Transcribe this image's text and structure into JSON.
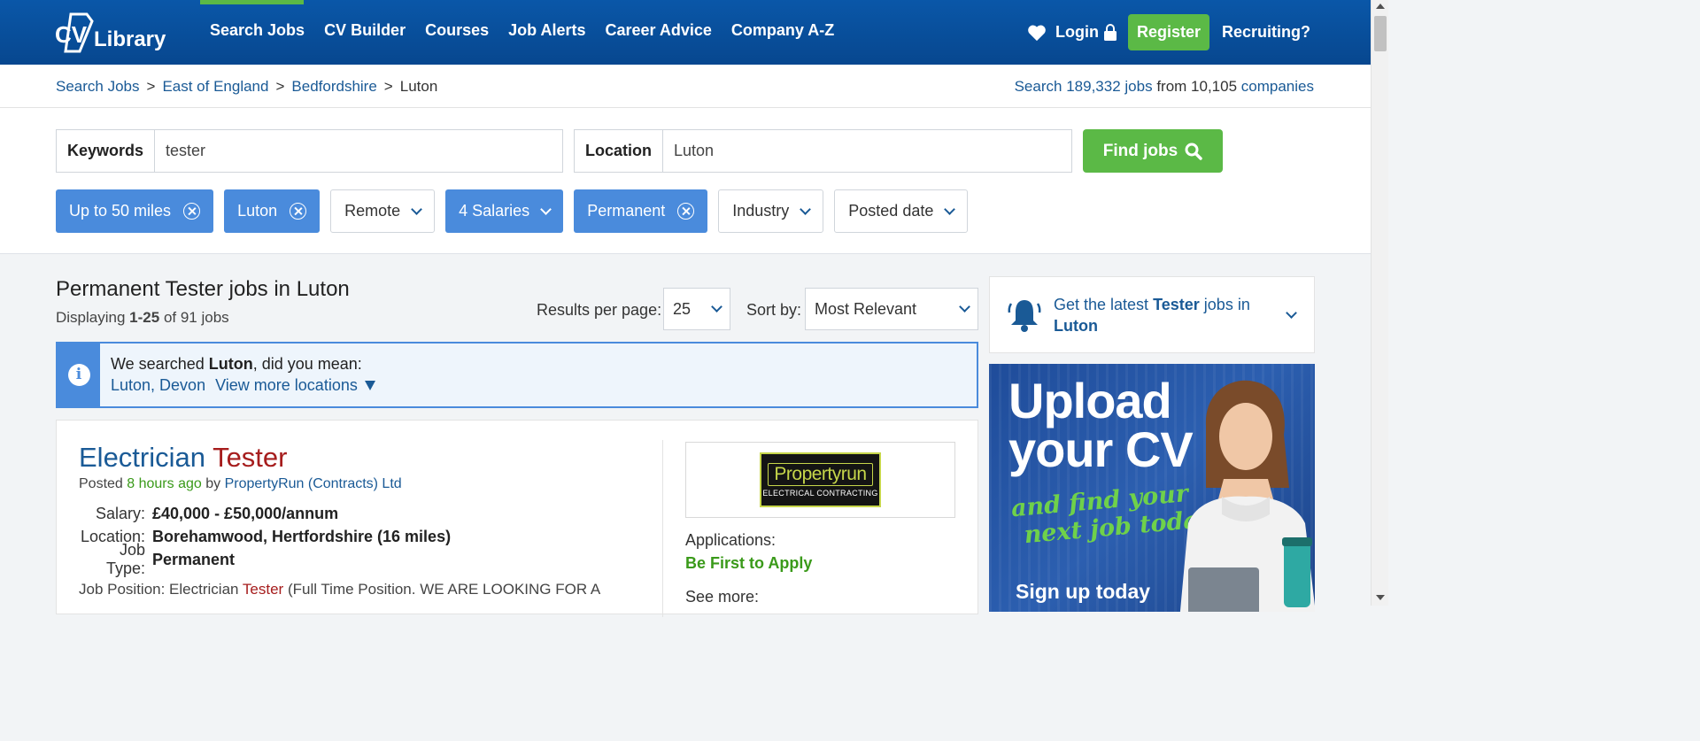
{
  "header": {
    "logo_text": "CV Library",
    "nav": [
      "Search Jobs",
      "CV Builder",
      "Courses",
      "Job Alerts",
      "Career Advice",
      "Company A-Z"
    ],
    "login": "Login",
    "register": "Register",
    "recruiting": "Recruiting?"
  },
  "breadcrumb": {
    "items": [
      "Search Jobs",
      "East of England",
      "Bedfordshire"
    ],
    "current": "Luton",
    "stats_prefix": "Search",
    "jobs_count": "189,332 jobs",
    "stats_mid": "from 10,105",
    "companies": "companies"
  },
  "search": {
    "keywords_label": "Keywords",
    "keywords_value": "tester",
    "location_label": "Location",
    "location_value": "Luton",
    "find_button": "Find jobs"
  },
  "filters": [
    {
      "label": "Up to 50 miles",
      "active": true,
      "kind": "remove"
    },
    {
      "label": "Luton",
      "active": true,
      "kind": "remove"
    },
    {
      "label": "Remote",
      "active": false,
      "kind": "dropdown"
    },
    {
      "label": "4 Salaries",
      "active": true,
      "kind": "dropdown"
    },
    {
      "label": "Permanent",
      "active": true,
      "kind": "remove"
    },
    {
      "label": "Industry",
      "active": false,
      "kind": "dropdown"
    },
    {
      "label": "Posted date",
      "active": false,
      "kind": "dropdown"
    }
  ],
  "results": {
    "title": "Permanent Tester jobs in Luton",
    "displaying_prefix": "Displaying",
    "range": "1-25",
    "of_text": "of 91 jobs",
    "per_page_label": "Results per page:",
    "per_page_value": "25",
    "sort_label": "Sort by:",
    "sort_value": "Most Relevant"
  },
  "did_you_mean": {
    "prefix": "We searched",
    "term": "Luton",
    "suffix": ", did you mean:",
    "suggestion": "Luton, Devon",
    "more": "View more locations"
  },
  "job": {
    "title_main": "Electrician",
    "title_highlight": "Tester",
    "posted_label": "Posted",
    "posted_ago": "8 hours ago",
    "posted_by": "by",
    "company": "PropertyRun (Contracts) Ltd",
    "salary_label": "Salary:",
    "salary": "£40,000 - £50,000/annum",
    "location_label": "Location:",
    "location": "Borehamwood, Hertfordshire (16 miles)",
    "type_label": "Job Type:",
    "type": "Permanent",
    "desc_prefix": "Job Position: Electrician",
    "desc_highlight": "Tester",
    "desc_suffix": "(Full Time Position. WE ARE LOOKING FOR A",
    "logo_name": "Propertyrun",
    "logo_sub": "ELECTRICAL CONTRACTING",
    "applications_label": "Applications:",
    "applications_value": "Be First to Apply",
    "see_more": "See more:"
  },
  "alert": {
    "prefix": "Get the latest",
    "term": "Tester",
    "mid": "jobs in",
    "place": "Luton"
  },
  "ad": {
    "headline_1": "Upload",
    "headline_2": "your CV",
    "tagline_1": "and find your",
    "tagline_2": "next job today!",
    "cta": "Sign up today"
  },
  "colors": {
    "brand_blue": "#0a57a8",
    "accent_green": "#5bb946",
    "chip_blue": "#4a8bdc",
    "link": "#1a5a96",
    "highlight_red": "#a61d1d"
  }
}
